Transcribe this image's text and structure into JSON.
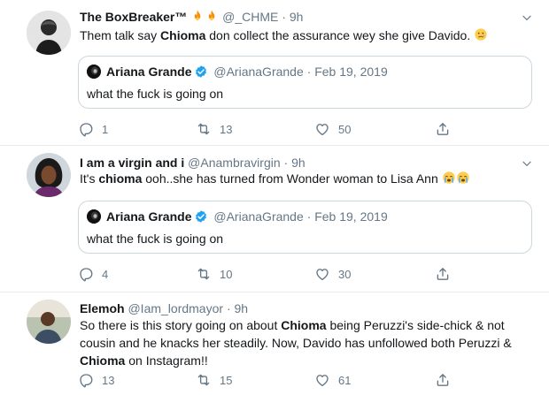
{
  "tweets": [
    {
      "name": "The BoxBreaker™",
      "handle": "@_CHME",
      "separator": "·",
      "time": "9h",
      "text_parts": [
        "Them talk say ",
        "Chioma",
        " don collect the assurance wey she give Davido. "
      ],
      "quote": {
        "name": "Ariana Grande",
        "handle": "@ArianaGrande",
        "separator": "·",
        "date": "Feb 19, 2019",
        "text": "what the fuck is going on"
      },
      "replies": "1",
      "retweets": "13",
      "likes": "50"
    },
    {
      "name": "I am a virgin and i",
      "handle": "@Anambravirgin",
      "separator": "·",
      "time": "9h",
      "text_parts": [
        "It's ",
        "chioma",
        " ooh..she has turned from Wonder woman to Lisa Ann "
      ],
      "quote": {
        "name": "Ariana Grande",
        "handle": "@ArianaGrande",
        "separator": "·",
        "date": "Feb 19, 2019",
        "text": "what the fuck is going on"
      },
      "replies": "4",
      "retweets": "10",
      "likes": "30"
    },
    {
      "name": "Elemoh",
      "handle": "@Iam_lordmayor",
      "separator": "·",
      "time": "9h",
      "text_parts": [
        "So there is this story going on about ",
        "Chioma",
        " being Peruzzi's side-chick & not cousin and he knacks her steadily. Now, Davido has unfollowed both Peruzzi & ",
        "Chioma",
        " on Instagram!!"
      ],
      "replies": "13",
      "retweets": "15",
      "likes": "61"
    }
  ],
  "icons": {
    "reply": "reply-icon",
    "retweet": "retweet-icon",
    "like": "heart-icon",
    "share": "share-icon",
    "more": "chevron-down-icon",
    "verified": "verified-badge-icon",
    "fire": "fire-emoji",
    "sad": "sad-face-emoji",
    "crying": "crying-face-emoji"
  },
  "colors": {
    "text": "#14171a",
    "muted": "#657786",
    "border": "#e6ecf0",
    "quote_border": "#ccd6dd",
    "verified": "#1da1f2"
  }
}
